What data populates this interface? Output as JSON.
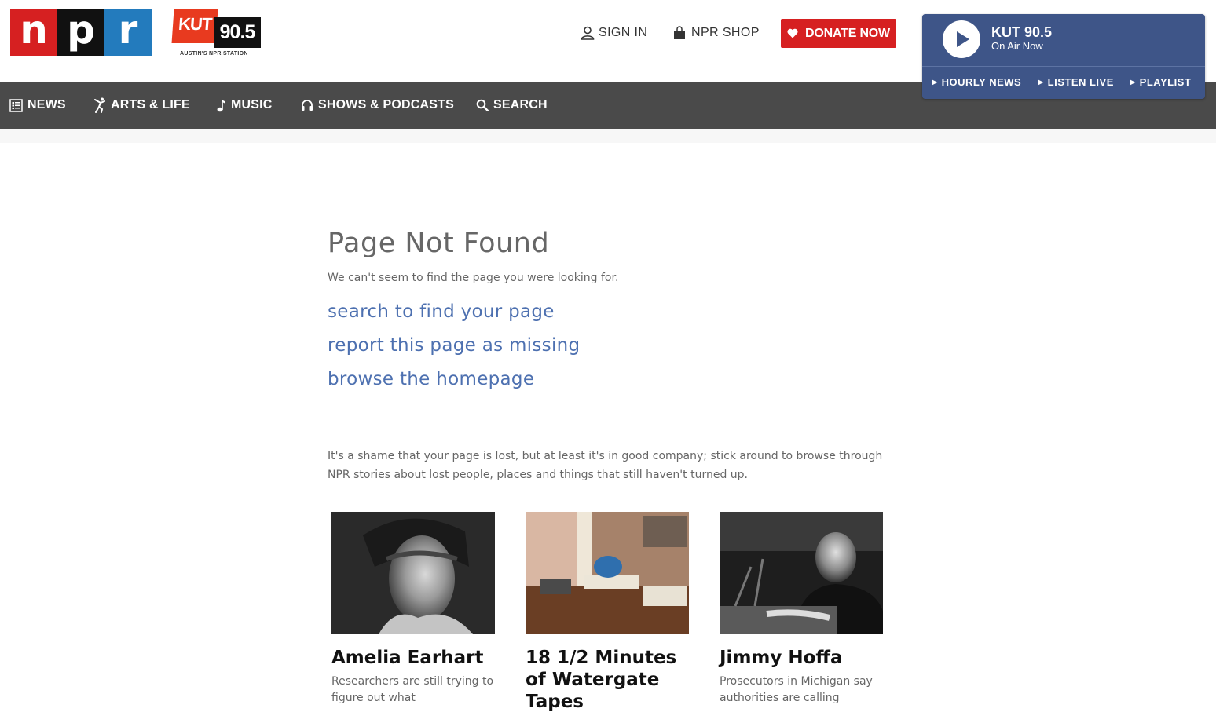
{
  "header": {
    "npr_logo": {
      "n": "n",
      "p": "p",
      "r": "r"
    },
    "station_logo": {
      "kut": "KUT",
      "freq": "90.5",
      "tagline": "AUSTIN'S NPR STATION"
    },
    "sign_in": "SIGN IN",
    "shop": "NPR SHOP",
    "donate": "DONATE NOW",
    "icons": {
      "sign_in": "user-icon",
      "shop": "shopping-bag-icon",
      "donate": "heart-icon"
    }
  },
  "player": {
    "station": "KUT 90.5",
    "status": "On Air Now",
    "links": [
      "HOURLY NEWS",
      "LISTEN LIVE",
      "PLAYLIST"
    ],
    "colors": {
      "background": "#3e5588"
    }
  },
  "nav": {
    "items": [
      {
        "label": "NEWS",
        "icon": "newspaper-icon"
      },
      {
        "label": "ARTS & LIFE",
        "icon": "dancer-icon"
      },
      {
        "label": "MUSIC",
        "icon": "music-note-icon"
      },
      {
        "label": "SHOWS & PODCASTS",
        "icon": "headphones-icon"
      },
      {
        "label": "SEARCH",
        "icon": "search-icon"
      }
    ]
  },
  "main": {
    "title": "Page Not Found",
    "subtitle": "We can't seem to find the page you were looking for.",
    "links": [
      "search to find your page",
      "report this page as missing",
      "browse the homepage"
    ],
    "blurb": "It's a shame that your page is lost, but at least it's in good company; stick around to browse through NPR stories about lost people, places and things that still haven't turned up."
  },
  "cards": [
    {
      "title": "Amelia Earhart",
      "desc": "Researchers are still trying to figure out what"
    },
    {
      "title": "18 1/2 Minutes of Watergate Tapes",
      "desc": ""
    },
    {
      "title": "Jimmy Hoffa",
      "desc": "Prosecutors in Michigan say authorities are calling"
    }
  ],
  "colors": {
    "npr_red": "#d62021",
    "npr_black": "#111111",
    "npr_blue": "#237bbd",
    "nav_bg": "#4a4a4a",
    "link": "#4d70b0",
    "donate": "#d62021"
  }
}
